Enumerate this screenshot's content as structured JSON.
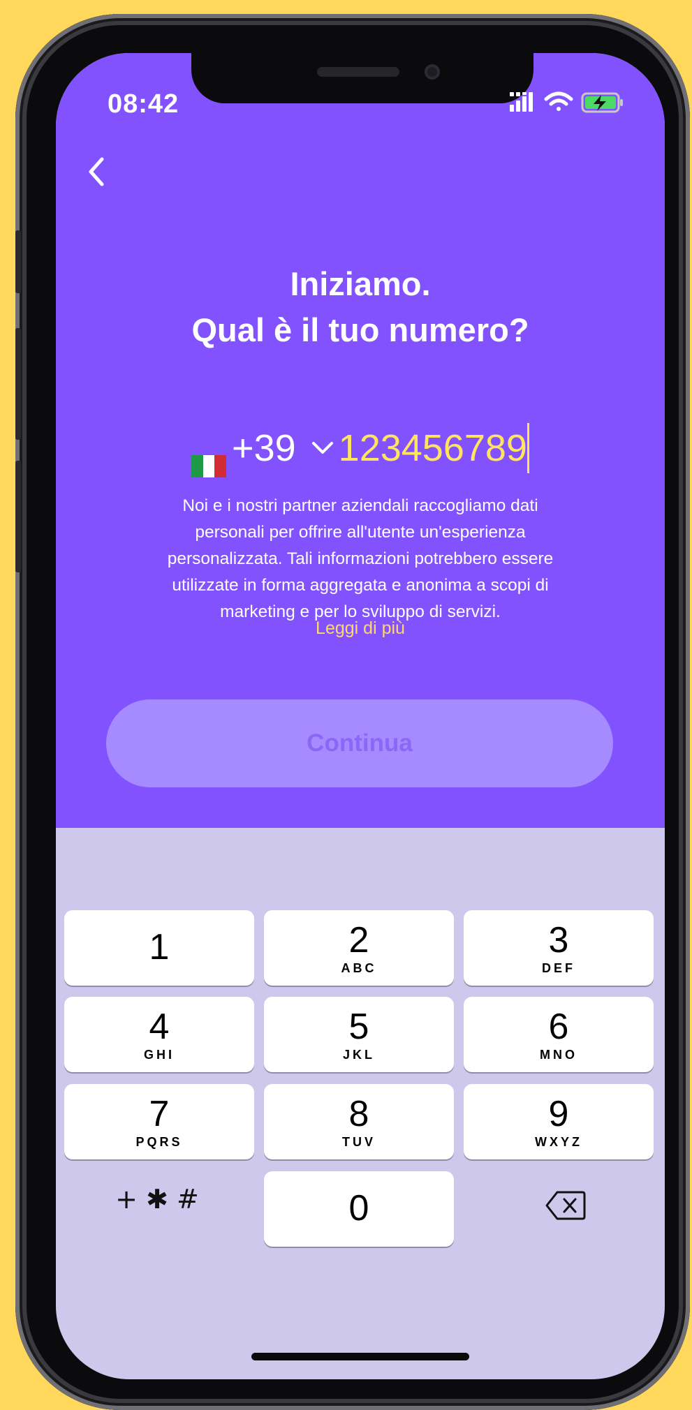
{
  "status_bar": {
    "time": "08:42"
  },
  "header": {
    "title_line1": "Iniziamo.",
    "title_line2": "Qual è il tuo numero?"
  },
  "phone_input": {
    "country_code": "+39",
    "value": "123456789"
  },
  "disclaimer": {
    "line1": "Noi e i nostri partner aziendali raccogliamo dati",
    "line2": "personali per offrire all'utente un'esperienza",
    "line3": "personalizzata. Tali informazioni potrebbero essere",
    "line4": "utilizzate in forma aggregata e anonima a scopi di",
    "line5": "marketing e per lo sviluppo di servizi.",
    "read_more": "Leggi di più"
  },
  "continue_button": {
    "label": "Continua"
  },
  "keypad": {
    "keys": [
      {
        "digit": "1",
        "letters": ""
      },
      {
        "digit": "2",
        "letters": "ABC"
      },
      {
        "digit": "3",
        "letters": "DEF"
      },
      {
        "digit": "4",
        "letters": "GHI"
      },
      {
        "digit": "5",
        "letters": "JKL"
      },
      {
        "digit": "6",
        "letters": "MNO"
      },
      {
        "digit": "7",
        "letters": "PQRS"
      },
      {
        "digit": "8",
        "letters": "TUV"
      },
      {
        "digit": "9",
        "letters": "WXYZ"
      },
      {
        "digit": "0",
        "letters": ""
      }
    ],
    "symbols": "+ ✱ #"
  },
  "colors": {
    "background": "#FFD85C",
    "brand_purple": "#8252FF",
    "accent_yellow": "#FFE45E",
    "keyboard_bg": "#CDC8EC"
  }
}
